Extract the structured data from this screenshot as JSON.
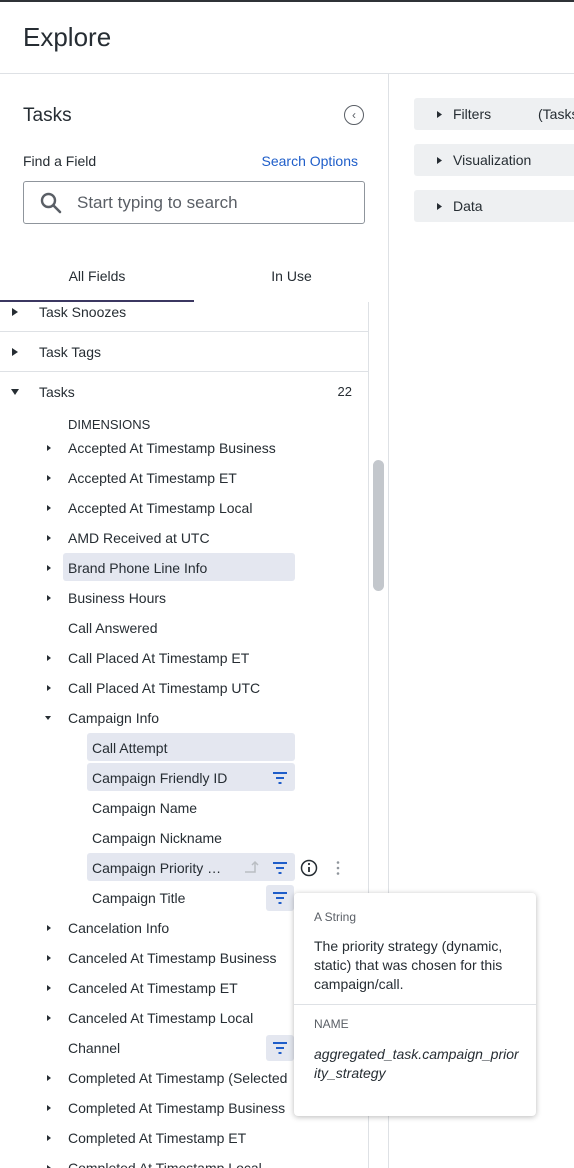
{
  "header": {
    "title": "Explore"
  },
  "sidebar": {
    "title": "Tasks",
    "find_label": "Find a Field",
    "search_options": "Search Options",
    "search_placeholder": "Start typing to search",
    "tabs": [
      {
        "label": "All Fields"
      },
      {
        "label": "In Use"
      }
    ],
    "groups": [
      {
        "label": "Task Snoozes",
        "expanded": false
      },
      {
        "label": "Task Tags",
        "expanded": false
      },
      {
        "label": "Tasks",
        "expanded": true,
        "count": "22"
      }
    ],
    "dimensions_header": "DIMENSIONS",
    "fields": [
      {
        "label": "Accepted At Timestamp Business"
      },
      {
        "label": "Accepted At Timestamp ET"
      },
      {
        "label": "Accepted At Timestamp Local"
      },
      {
        "label": "AMD Received at UTC"
      },
      {
        "label": "Brand Phone Line Info",
        "highlighted": true
      },
      {
        "label": "Business Hours"
      },
      {
        "label": "Call Answered"
      },
      {
        "label": "Call Placed At Timestamp ET"
      },
      {
        "label": "Call Placed At Timestamp UTC"
      },
      {
        "label": "Campaign Info",
        "expanded": true
      },
      {
        "label": "Call Attempt",
        "highlighted": true
      },
      {
        "label": "Campaign Friendly ID",
        "highlighted": true
      },
      {
        "label": "Campaign Name"
      },
      {
        "label": "Campaign Nickname"
      },
      {
        "label": "Campaign Priority …",
        "highlighted": true
      },
      {
        "label": "Campaign Title"
      },
      {
        "label": "Cancelation Info"
      },
      {
        "label": "Canceled At Timestamp Business"
      },
      {
        "label": "Canceled At Timestamp ET"
      },
      {
        "label": "Canceled At Timestamp Local"
      },
      {
        "label": "Channel"
      },
      {
        "label": "Completed At Timestamp (Selected"
      },
      {
        "label": "Completed At Timestamp Business"
      },
      {
        "label": "Completed At Timestamp ET"
      },
      {
        "label": "Completed At Timestamp Local"
      }
    ]
  },
  "tooltip": {
    "type": "A  String",
    "description": "The priority strategy (dynamic, static) that was chosen for this campaign/call.",
    "name_label": "NAME",
    "name": "aggregated_task.campaign_priority_strategy"
  },
  "main": {
    "panels": [
      {
        "label": "Filters",
        "sub": "(Tasks"
      },
      {
        "label": "Visualization"
      },
      {
        "label": "Data"
      }
    ]
  },
  "colors": {
    "accent": "#3b3761",
    "link": "#1f5ec9",
    "highlight": "#e4e7f0",
    "panel": "#eef0f2"
  }
}
